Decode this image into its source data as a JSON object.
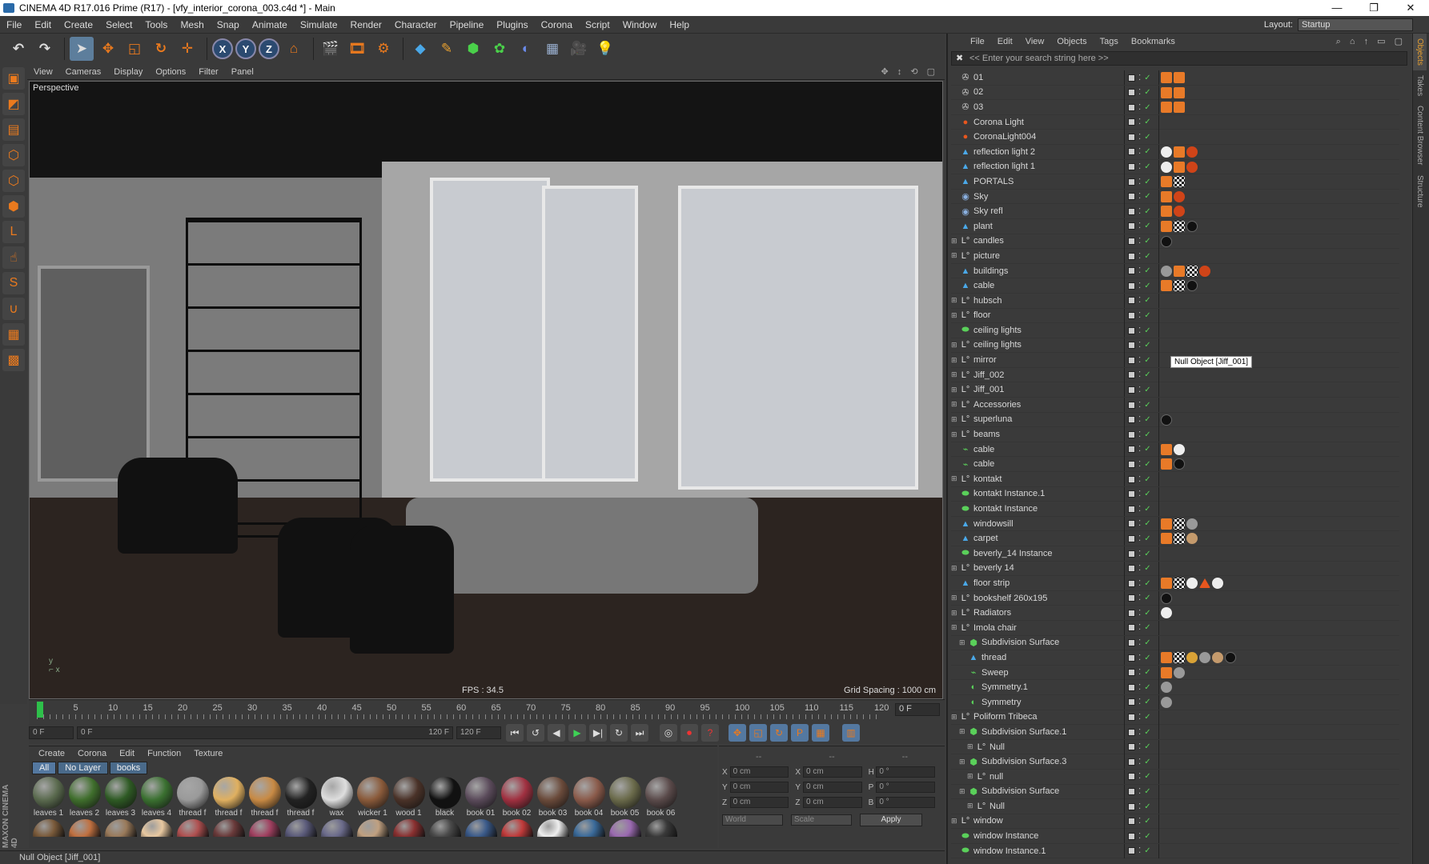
{
  "window": {
    "title": "CINEMA 4D R17.016 Prime (R17) - [vfy_interior_corona_003.c4d *] - Main",
    "controls": [
      "—",
      "❐",
      "✕"
    ]
  },
  "menu": [
    "File",
    "Edit",
    "Create",
    "Select",
    "Tools",
    "Mesh",
    "Snap",
    "Animate",
    "Simulate",
    "Render",
    "Character",
    "Pipeline",
    "Plugins",
    "Corona",
    "Script",
    "Window",
    "Help"
  ],
  "layout": {
    "label": "Layout:",
    "value": "Startup"
  },
  "toolbar": {
    "axis_x": "X",
    "axis_y": "Y",
    "axis_z": "Z"
  },
  "viewport": {
    "menu": [
      "View",
      "Cameras",
      "Display",
      "Options",
      "Filter",
      "Panel"
    ],
    "label": "Perspective",
    "fps": "FPS : 34.5",
    "grid": "Grid Spacing : 1000 cm"
  },
  "timeline": {
    "ticks": [
      "0",
      "5",
      "10",
      "15",
      "20",
      "25",
      "30",
      "35",
      "40",
      "45",
      "50",
      "55",
      "60",
      "65",
      "70",
      "75",
      "80",
      "85",
      "90",
      "95",
      "100",
      "105",
      "110",
      "115",
      "120"
    ],
    "current_frame": "0 F",
    "start": "0 F",
    "range_start": "0 F",
    "range_end": "120 F",
    "end": "120 F"
  },
  "materials": {
    "menu": [
      "Create",
      "Corona",
      "Edit",
      "Function",
      "Texture"
    ],
    "filters": [
      "All",
      "No Layer",
      "books"
    ],
    "row1": [
      {
        "label": "leaves 1",
        "color": "#5a6a4e"
      },
      {
        "label": "leaves 2",
        "color": "#3f6e2c"
      },
      {
        "label": "leaves 3",
        "color": "#2e5a24"
      },
      {
        "label": "leaves 4",
        "color": "#3a7030"
      },
      {
        "label": "thread f",
        "color": "#9a9a9a"
      },
      {
        "label": "thread f",
        "color": "#e0b060"
      },
      {
        "label": "thread f",
        "color": "#c88a44"
      },
      {
        "label": "thread f",
        "color": "#222222"
      },
      {
        "label": "wax",
        "color": "#dedede"
      },
      {
        "label": "wicker 1",
        "color": "#8a5a3a"
      },
      {
        "label": "wood 1",
        "color": "#4a3228"
      },
      {
        "label": "black",
        "color": "#111111"
      },
      {
        "label": "book 01",
        "color": "#5a4a5a"
      },
      {
        "label": "book 02",
        "color": "#a03040"
      },
      {
        "label": "book 03",
        "color": "#6a4a3a"
      },
      {
        "label": "book 04",
        "color": "#8a5a4a"
      },
      {
        "label": "book 05",
        "color": "#6a6a4a"
      },
      {
        "label": "book 06",
        "color": "#5a4a4a"
      }
    ],
    "row2_colors": [
      "#7a5a3a",
      "#c07040",
      "#9a7a5a",
      "#e8c8a0",
      "#b05050",
      "#6a3a3a",
      "#a04060",
      "#5a5a7a",
      "#6a6a8a",
      "#c0a080",
      "#8a3030",
      "#4a4a4a",
      "#3a5a8a",
      "#c03a3a",
      "#eeeeee",
      "#3a6a9a",
      "#9a6ab0",
      "#3a3a3a"
    ]
  },
  "coords": {
    "header": [
      "--",
      "--",
      "--"
    ],
    "rows": [
      {
        "l1": "X",
        "v1": "0 cm",
        "l2": "X",
        "v2": "0 cm",
        "l3": "H",
        "v3": "0 °"
      },
      {
        "l1": "Y",
        "v1": "0 cm",
        "l2": "Y",
        "v2": "0 cm",
        "l3": "P",
        "v3": "0 °"
      },
      {
        "l1": "Z",
        "v1": "0 cm",
        "l2": "Z",
        "v2": "0 cm",
        "l3": "B",
        "v3": "0 °"
      }
    ],
    "mode1": "World",
    "mode2": "Scale",
    "apply": "Apply"
  },
  "status": "Null Object [Jiff_001]",
  "brand": "MAXON CINEMA 4D",
  "objects": {
    "menu": [
      "File",
      "Edit",
      "View",
      "Objects",
      "Tags",
      "Bookmarks"
    ],
    "search_placeholder": "<< Enter your search string here >>",
    "tooltip": "Null Object [Jiff_001]",
    "items": [
      {
        "name": "01",
        "icon": "cam",
        "indent": 0,
        "tags": [
          "orange",
          "orange"
        ]
      },
      {
        "name": "02",
        "icon": "cam",
        "indent": 0,
        "tags": [
          "orange",
          "orange"
        ]
      },
      {
        "name": "03",
        "icon": "cam",
        "indent": 0,
        "tags": [
          "orange",
          "orange"
        ]
      },
      {
        "name": "Corona Light",
        "icon": "light",
        "indent": 0,
        "tags": []
      },
      {
        "name": "CoronaLight004",
        "icon": "light",
        "indent": 0,
        "tags": []
      },
      {
        "name": "reflection light 2",
        "icon": "poly",
        "indent": 0,
        "tags": [
          "white",
          "orange",
          "red"
        ]
      },
      {
        "name": "reflection light 1",
        "icon": "poly",
        "indent": 0,
        "tags": [
          "white",
          "orange",
          "red"
        ]
      },
      {
        "name": "PORTALS",
        "icon": "poly",
        "indent": 0,
        "tags": [
          "orange",
          "check"
        ]
      },
      {
        "name": "Sky",
        "icon": "sky",
        "indent": 0,
        "tags": [
          "orange",
          "red"
        ]
      },
      {
        "name": "Sky refl",
        "icon": "sky",
        "indent": 0,
        "tags": [
          "orange",
          "red"
        ]
      },
      {
        "name": "plant",
        "icon": "poly",
        "indent": 0,
        "tags": [
          "orange",
          "check",
          "black"
        ]
      },
      {
        "name": "candles",
        "icon": "null",
        "indent": 0,
        "tags": [
          "black"
        ]
      },
      {
        "name": "picture",
        "icon": "null",
        "indent": 0,
        "tags": []
      },
      {
        "name": "buildings",
        "icon": "poly",
        "indent": 0,
        "tags": [
          "grey",
          "orange",
          "check",
          "red"
        ]
      },
      {
        "name": "cable",
        "icon": "poly",
        "indent": 0,
        "tags": [
          "orange",
          "check",
          "black"
        ]
      },
      {
        "name": "hubsch",
        "icon": "null",
        "indent": 0,
        "tags": []
      },
      {
        "name": "floor",
        "icon": "null",
        "indent": 0,
        "tags": []
      },
      {
        "name": "ceiling lights",
        "icon": "inst",
        "indent": 0,
        "tags": []
      },
      {
        "name": "ceiling lights",
        "icon": "null",
        "indent": 0,
        "tags": []
      },
      {
        "name": "mirror",
        "icon": "null",
        "indent": 0,
        "tags": []
      },
      {
        "name": "Jiff_002",
        "icon": "null",
        "indent": 0,
        "tags": []
      },
      {
        "name": "Jiff_001",
        "icon": "null",
        "indent": 0,
        "tags": []
      },
      {
        "name": "Accessories",
        "icon": "null",
        "indent": 0,
        "tags": []
      },
      {
        "name": "superluna",
        "icon": "null",
        "indent": 0,
        "tags": [
          "black"
        ]
      },
      {
        "name": "beams",
        "icon": "null",
        "indent": 0,
        "tags": []
      },
      {
        "name": "cable",
        "icon": "sweep",
        "indent": 0,
        "tags": [
          "orange",
          "white"
        ]
      },
      {
        "name": "cable",
        "icon": "sweep",
        "indent": 0,
        "tags": [
          "orange",
          "black"
        ]
      },
      {
        "name": "kontakt",
        "icon": "null",
        "indent": 0,
        "tags": []
      },
      {
        "name": "kontakt Instance.1",
        "icon": "inst",
        "indent": 0,
        "tags": []
      },
      {
        "name": "kontakt Instance",
        "icon": "inst",
        "indent": 0,
        "tags": []
      },
      {
        "name": "windowsill",
        "icon": "poly",
        "indent": 0,
        "tags": [
          "orange",
          "check",
          "grey"
        ]
      },
      {
        "name": "carpet",
        "icon": "poly",
        "indent": 0,
        "tags": [
          "orange",
          "check",
          "tan"
        ]
      },
      {
        "name": "beverly_14 Instance",
        "icon": "inst",
        "indent": 0,
        "tags": []
      },
      {
        "name": "beverly 14",
        "icon": "null",
        "indent": 0,
        "tags": []
      },
      {
        "name": "floor strip",
        "icon": "poly",
        "indent": 0,
        "tags": [
          "orange",
          "check",
          "white",
          "tri",
          "white"
        ]
      },
      {
        "name": "bookshelf 260x195",
        "icon": "null",
        "indent": 0,
        "tags": [
          "black"
        ]
      },
      {
        "name": "Radiators",
        "icon": "null",
        "indent": 0,
        "tags": [
          "white"
        ]
      },
      {
        "name": "Imola chair",
        "icon": "null",
        "indent": 0,
        "tags": []
      },
      {
        "name": "Subdivision Surface",
        "icon": "sds",
        "indent": 1,
        "tags": []
      },
      {
        "name": "thread",
        "icon": "poly",
        "indent": 1,
        "tags": [
          "orange",
          "check",
          "gold",
          "grey",
          "tan",
          "black"
        ]
      },
      {
        "name": "Sweep",
        "icon": "sweep",
        "indent": 1,
        "tags": [
          "orange",
          "grey"
        ]
      },
      {
        "name": "Symmetry.1",
        "icon": "sym",
        "indent": 1,
        "tags": [
          "grey"
        ]
      },
      {
        "name": "Symmetry",
        "icon": "sym",
        "indent": 1,
        "tags": [
          "grey"
        ]
      },
      {
        "name": "Poliform Tribeca",
        "icon": "null",
        "indent": 0,
        "tags": []
      },
      {
        "name": "Subdivision Surface.1",
        "icon": "sds",
        "indent": 1,
        "tags": []
      },
      {
        "name": "Null",
        "icon": "null",
        "indent": 2,
        "tags": []
      },
      {
        "name": "Subdivision Surface.3",
        "icon": "sds",
        "indent": 1,
        "tags": []
      },
      {
        "name": "null",
        "icon": "null",
        "indent": 2,
        "tags": []
      },
      {
        "name": "Subdivision Surface",
        "icon": "sds",
        "indent": 1,
        "tags": []
      },
      {
        "name": "Null",
        "icon": "null",
        "indent": 2,
        "tags": []
      },
      {
        "name": "window",
        "icon": "null",
        "indent": 0,
        "tags": []
      },
      {
        "name": "window Instance",
        "icon": "inst",
        "indent": 0,
        "tags": []
      },
      {
        "name": "window Instance.1",
        "icon": "inst",
        "indent": 0,
        "tags": []
      }
    ]
  },
  "side_tabs": [
    "Objects",
    "Takes",
    "Content Browser",
    "Structure"
  ]
}
